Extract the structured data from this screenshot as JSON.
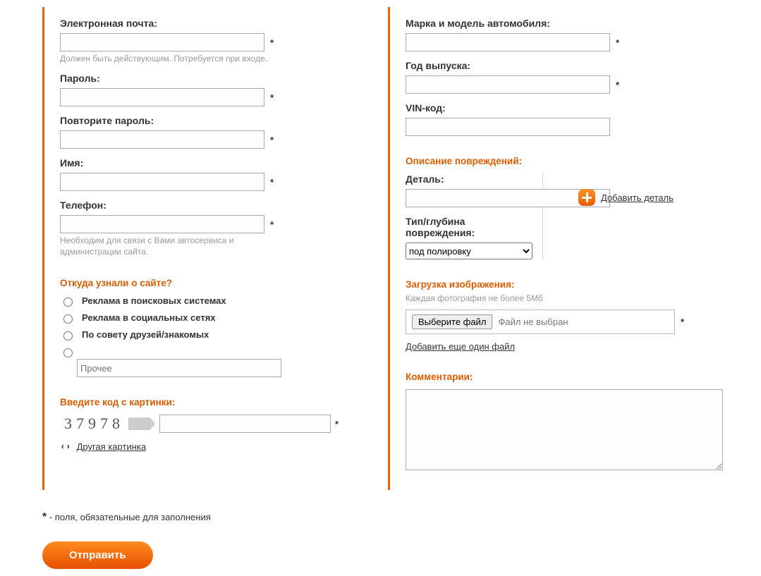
{
  "left": {
    "email_label": "Электронная почта:",
    "email_hint": "Должен быть действующим. Потребуется при входе.",
    "password_label": "Пароль:",
    "password2_label": "Повторите пароль:",
    "name_label": "Имя:",
    "phone_label": "Телефон:",
    "phone_hint": "Необходим для связи с Вами автосервиса и администрации сайта.",
    "source_title": "Откуда узнали о сайте?",
    "source": {
      "opt1": "Реклама в поисковых системах",
      "opt2": "Реклама в социальных сетях",
      "opt3": "По совету друзей/знакомых",
      "opt4_placeholder": "Прочее"
    },
    "captcha_title": "Введите код с картинки:",
    "captcha_code": "37978",
    "captcha_reload": "Другая картинка"
  },
  "right": {
    "car_label": "Марка и модель автомобиля:",
    "year_label": "Год выпуска:",
    "vin_label": "VIN-код:",
    "damage_title": "Описание повреждений:",
    "part_label": "Деталь:",
    "add_part": "Добавить деталь",
    "depth_label": "Тип/глубина повреждения:",
    "depth_selected": "под полировку",
    "upload_title": "Загрузка изображения:",
    "upload_hint": "Каждая фотография не более 5Мб",
    "choose_file": "Выберите файл",
    "no_file": "Файл не выбран",
    "add_file": "Добавить еще один файл",
    "comments_title": "Комментарии:"
  },
  "footer_note": " - поля, обязательные для заполнения",
  "submit": "Отправить",
  "star": "*"
}
